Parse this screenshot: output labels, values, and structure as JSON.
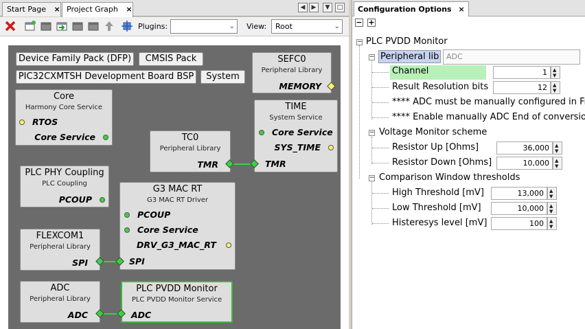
{
  "tabs": {
    "start_page": "Start Page",
    "project_graph": "Project Graph"
  },
  "toolbar": {
    "plugins_label": "Plugins:",
    "plugins_value": "",
    "view_label": "View:",
    "view_value": "Root"
  },
  "graph": {
    "pills": {
      "dfp": "Device Family Pack (DFP)",
      "cmsis": "CMSIS Pack",
      "bsp": "PIC32CXMTSH Development Board BSP",
      "system": "System"
    },
    "sefc0": {
      "title": "SEFC0",
      "subtitle": "Peripheral Library",
      "port": "MEMORY"
    },
    "core": {
      "title": "Core",
      "subtitle": "Harmony Core Service",
      "port1": "RTOS",
      "port2": "Core Service"
    },
    "time": {
      "title": "TIME",
      "subtitle": "System Service",
      "port1": "Core Service",
      "port2": "SYS_TIME",
      "port3": "TMR"
    },
    "tc0": {
      "title": "TC0",
      "subtitle": "Peripheral Library",
      "port": "TMR"
    },
    "plcphy": {
      "title": "PLC PHY Coupling",
      "subtitle": "PLC Coupling",
      "port": "PCOUP"
    },
    "g3mac": {
      "title": "G3 MAC RT",
      "subtitle": "G3 MAC RT Driver",
      "port1": "PCOUP",
      "port2": "Core Service",
      "port3": "DRV_G3_MAC_RT",
      "port4": "SPI"
    },
    "flexcom1": {
      "title": "FLEXCOM1",
      "subtitle": "Peripheral Library",
      "port": "SPI"
    },
    "adc": {
      "title": "ADC",
      "subtitle": "Peripheral Library",
      "port": "ADC"
    },
    "plcpvdd": {
      "title": "PLC PVDD Monitor",
      "subtitle": "PLC PVDD Monitor Service",
      "port": "ADC"
    }
  },
  "config": {
    "tab_label": "Configuration Options",
    "root": "PLC PVDD Monitor",
    "peripheral_lib_label": "Peripheral lib",
    "peripheral_lib_value": "ADC",
    "channel_label": "Channel",
    "channel_value": "1",
    "resolution_label": "Result Resolution bits",
    "resolution_value": "12",
    "note1": "**** ADC must be manually configured in Fre",
    "note2": "**** Enable manually ADC End of conversion",
    "vm_scheme": "Voltage Monitor scheme",
    "r_up_label": "Resistor Up [Ohms]",
    "r_up_value": "36,000",
    "r_down_label": "Resistor Down [Ohms]",
    "r_down_value": "10,000",
    "cw_thresholds": "Comparison Window thresholds",
    "high_label": "High Threshold [mV]",
    "high_value": "13,000",
    "low_label": "Low Threshold [mV]",
    "low_value": "10,000",
    "hyst_label": "Histeresys level [mV]",
    "hyst_value": "100"
  }
}
